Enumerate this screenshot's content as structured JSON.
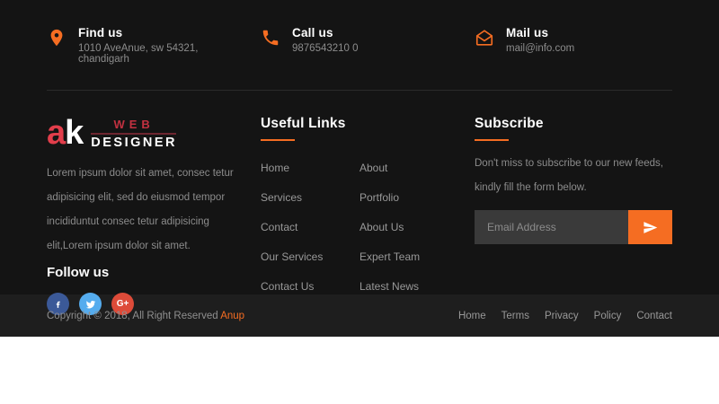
{
  "colors": {
    "accent": "#f56d22",
    "footer_bg": "#141414",
    "bottom_bg": "#1e1e1e",
    "logo_red": "#e23e4b",
    "web_red": "#c23140",
    "web_line": "#6e2630",
    "facebook": "#3b5998",
    "twitter": "#55acee",
    "google_plus": "#dd4b39"
  },
  "contact": {
    "items": [
      {
        "icon": "map-marker-icon",
        "title": "Find us",
        "subtitle": "1010 AveAnue, sw 54321, chandigarh"
      },
      {
        "icon": "phone-icon",
        "title": "Call us",
        "subtitle": "9876543210 0"
      },
      {
        "icon": "mail-icon",
        "title": "Mail us",
        "subtitle": "mail@info.com"
      }
    ]
  },
  "about": {
    "logo": {
      "mark_a": "a",
      "mark_k": "k",
      "top": "WEB",
      "bottom": "DESIGNER"
    },
    "description": "Lorem ipsum dolor sit amet, consec tetur adipisicing elit, sed do eiusmod tempor incididuntut consec tetur adipisicing elit,Lorem ipsum dolor sit amet.",
    "follow_heading": "Follow us",
    "social": [
      {
        "name": "facebook"
      },
      {
        "name": "twitter"
      },
      {
        "name": "google-plus",
        "glyph": "G+"
      }
    ]
  },
  "useful_links": {
    "heading": "Useful Links",
    "column1": [
      "Home",
      "Services",
      "Contact",
      "Our Services",
      "Contact Us"
    ],
    "column2": [
      "About",
      "Portfolio",
      "About Us",
      "Expert Team",
      "Latest News"
    ]
  },
  "subscribe": {
    "heading": "Subscribe",
    "description": "Don't miss to subscribe to our new feeds, kindly fill the form below.",
    "placeholder": "Email Address"
  },
  "bottom": {
    "copyright_prefix": "Copyright © 2018, All Right Reserved ",
    "copyright_brand": "Anup",
    "links": [
      "Home",
      "Terms",
      "Privacy",
      "Policy",
      "Contact"
    ]
  }
}
